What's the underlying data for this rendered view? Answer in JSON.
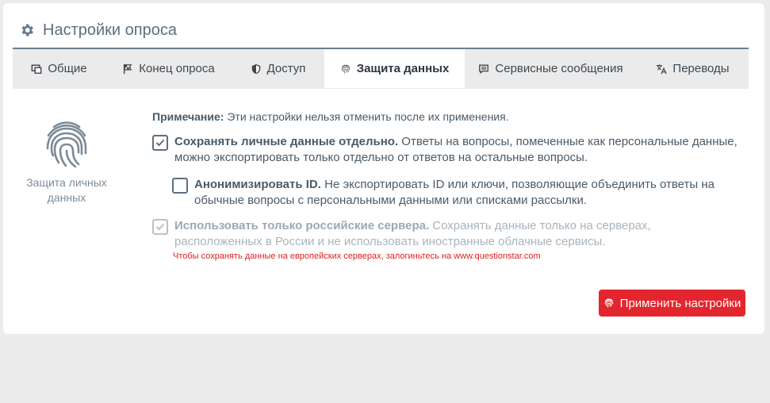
{
  "header": {
    "title": "Настройки опроса",
    "icon": "gear-icon"
  },
  "tabs": [
    {
      "label": "Общие",
      "icon": "monitor-icon"
    },
    {
      "label": "Конец опроса",
      "icon": "flag-icon"
    },
    {
      "label": "Доступ",
      "icon": "shield-icon"
    },
    {
      "label": "Защита данных",
      "icon": "fingerprint-icon",
      "active": true
    },
    {
      "label": "Сервисные сообщения",
      "icon": "message-icon"
    },
    {
      "label": "Переводы",
      "icon": "translate-icon"
    }
  ],
  "side": {
    "label": "Защита личных данных",
    "icon": "fingerprint-icon"
  },
  "note": {
    "label": "Примечание:",
    "text": " Эти настройки нельзя отменить после их применения."
  },
  "options": [
    {
      "title": "Сохранять личные данные отдельно.",
      "text": " Ответы на вопросы, помеченные как персональные данные, можно экспортировать только отдельно от ответов на остальные вопросы.",
      "checked": true,
      "disabled": false
    },
    {
      "title": "Анонимизировать ID.",
      "text": " Не экспортировать ID или ключи, позволяющие объединить ответы на обычные вопросы с персональными данными или списками рассылки.",
      "checked": false,
      "disabled": false
    },
    {
      "title": "Использовать только российские сервера.",
      "text": " Сохранять данные только на серверах, расположенных в России и не использовать иностранные облачные сервисы.",
      "checked": true,
      "disabled": true
    }
  ],
  "warning": "Чтобы сохранять данные на европейских серверах, залогиньтесь на www.questionstar.com",
  "apply_button": "Применить настройки",
  "colors": {
    "accent": "#e3262d",
    "tab_border": "#6e7f8d",
    "text": "#4a5a68"
  }
}
